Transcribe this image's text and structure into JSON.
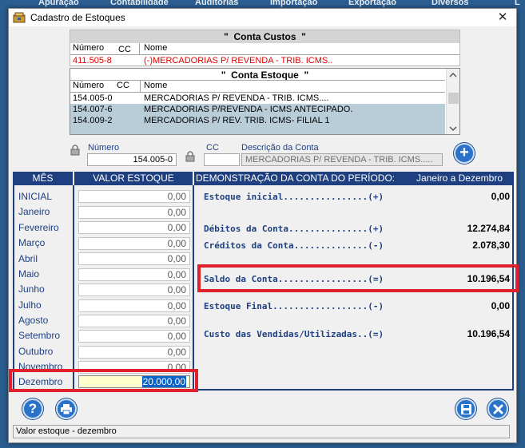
{
  "background_menu": [
    "Apuração",
    "Contabilidade",
    "Auditorias",
    "Importação",
    "Exportação",
    "Diversos",
    "L"
  ],
  "window": {
    "title": "Cadastro de Estoques",
    "close_glyph": "✕"
  },
  "conta_custos": {
    "banner": "\"  Conta Custos  \"",
    "col_numero": "Número",
    "col_cc": "CC",
    "col_nome": "Nome",
    "row": {
      "numero": "411.505-8",
      "nome": "(-)MERCADORIAS P/ REVENDA - TRIB. ICMS.."
    }
  },
  "conta_estoque": {
    "banner": "\"  Conta Estoque  \"",
    "col_numero": "Número",
    "col_cc": "CC",
    "col_nome": "Nome",
    "rows": [
      {
        "numero": "154.005-0",
        "nome": "MERCADORIAS P/ REVENDA - TRIB. ICMS...."
      },
      {
        "numero": "154.007-6",
        "nome": "MERCADORIAS P/REVENDA - ICMS ANTECIPADO."
      },
      {
        "numero": "154.009-2",
        "nome": "MERCADORIAS P/ REV. TRIB. ICMS- FILIAL 1"
      }
    ]
  },
  "fields": {
    "numero_label": "Número",
    "numero_value": "154.005-0",
    "cc_label": "CC",
    "cc_value": "",
    "descricao_label": "Descrição da Conta",
    "descricao_value": "MERCADORIAS P/ REVENDA - TRIB. ICMS....."
  },
  "columns": {
    "mes": "MÊS",
    "valor": "VALOR ESTOQUE",
    "demonstracao": "DEMONSTRAÇÃO DA CONTA DO PERÍODO:",
    "periodo": "Janeiro  a Dezembro"
  },
  "months": [
    {
      "name": "INICIAL",
      "value": "0,00"
    },
    {
      "name": "Janeiro",
      "value": "0,00"
    },
    {
      "name": "Fevereiro",
      "value": "0,00"
    },
    {
      "name": "Março",
      "value": "0,00"
    },
    {
      "name": "Abril",
      "value": "0,00"
    },
    {
      "name": "Maio",
      "value": "0,00"
    },
    {
      "name": "Junho",
      "value": "0,00"
    },
    {
      "name": "Julho",
      "value": "0,00"
    },
    {
      "name": "Agosto",
      "value": "0,00"
    },
    {
      "name": "Setembro",
      "value": "0,00"
    },
    {
      "name": "Outubro",
      "value": "0,00"
    },
    {
      "name": "Novembro",
      "value": "0,00"
    },
    {
      "name": "Dezembro",
      "value": "20.000,00"
    }
  ],
  "demonstracao": {
    "estoque_inicial": {
      "label": "Estoque inicial................(+)",
      "value": "0,00"
    },
    "debitos": {
      "label": "Débitos da Conta...............(+)",
      "value": "12.274,84"
    },
    "creditos": {
      "label": "Créditos da Conta..............(-)",
      "value": "2.078,30"
    },
    "saldo": {
      "label": "Saldo da Conta.................(=)",
      "value": "10.196,54"
    },
    "estoque_final": {
      "label": "Estoque Final..................(-)",
      "value": "0,00"
    },
    "custo": {
      "label": "Custo das Vendidas/Utilizadas..(=)",
      "value": "10.196,54"
    }
  },
  "buttons": {
    "add": "+",
    "help": "?"
  },
  "status_bar": "Valor estoque - dezembro",
  "colors": {
    "header_blue": "#1e3f80",
    "highlight_red": "#e0202a",
    "selected_row": "#b9cdd9",
    "red_text": "#e00000",
    "input_yellow": "#ffffcc",
    "selection_blue": "#0a64c8"
  }
}
